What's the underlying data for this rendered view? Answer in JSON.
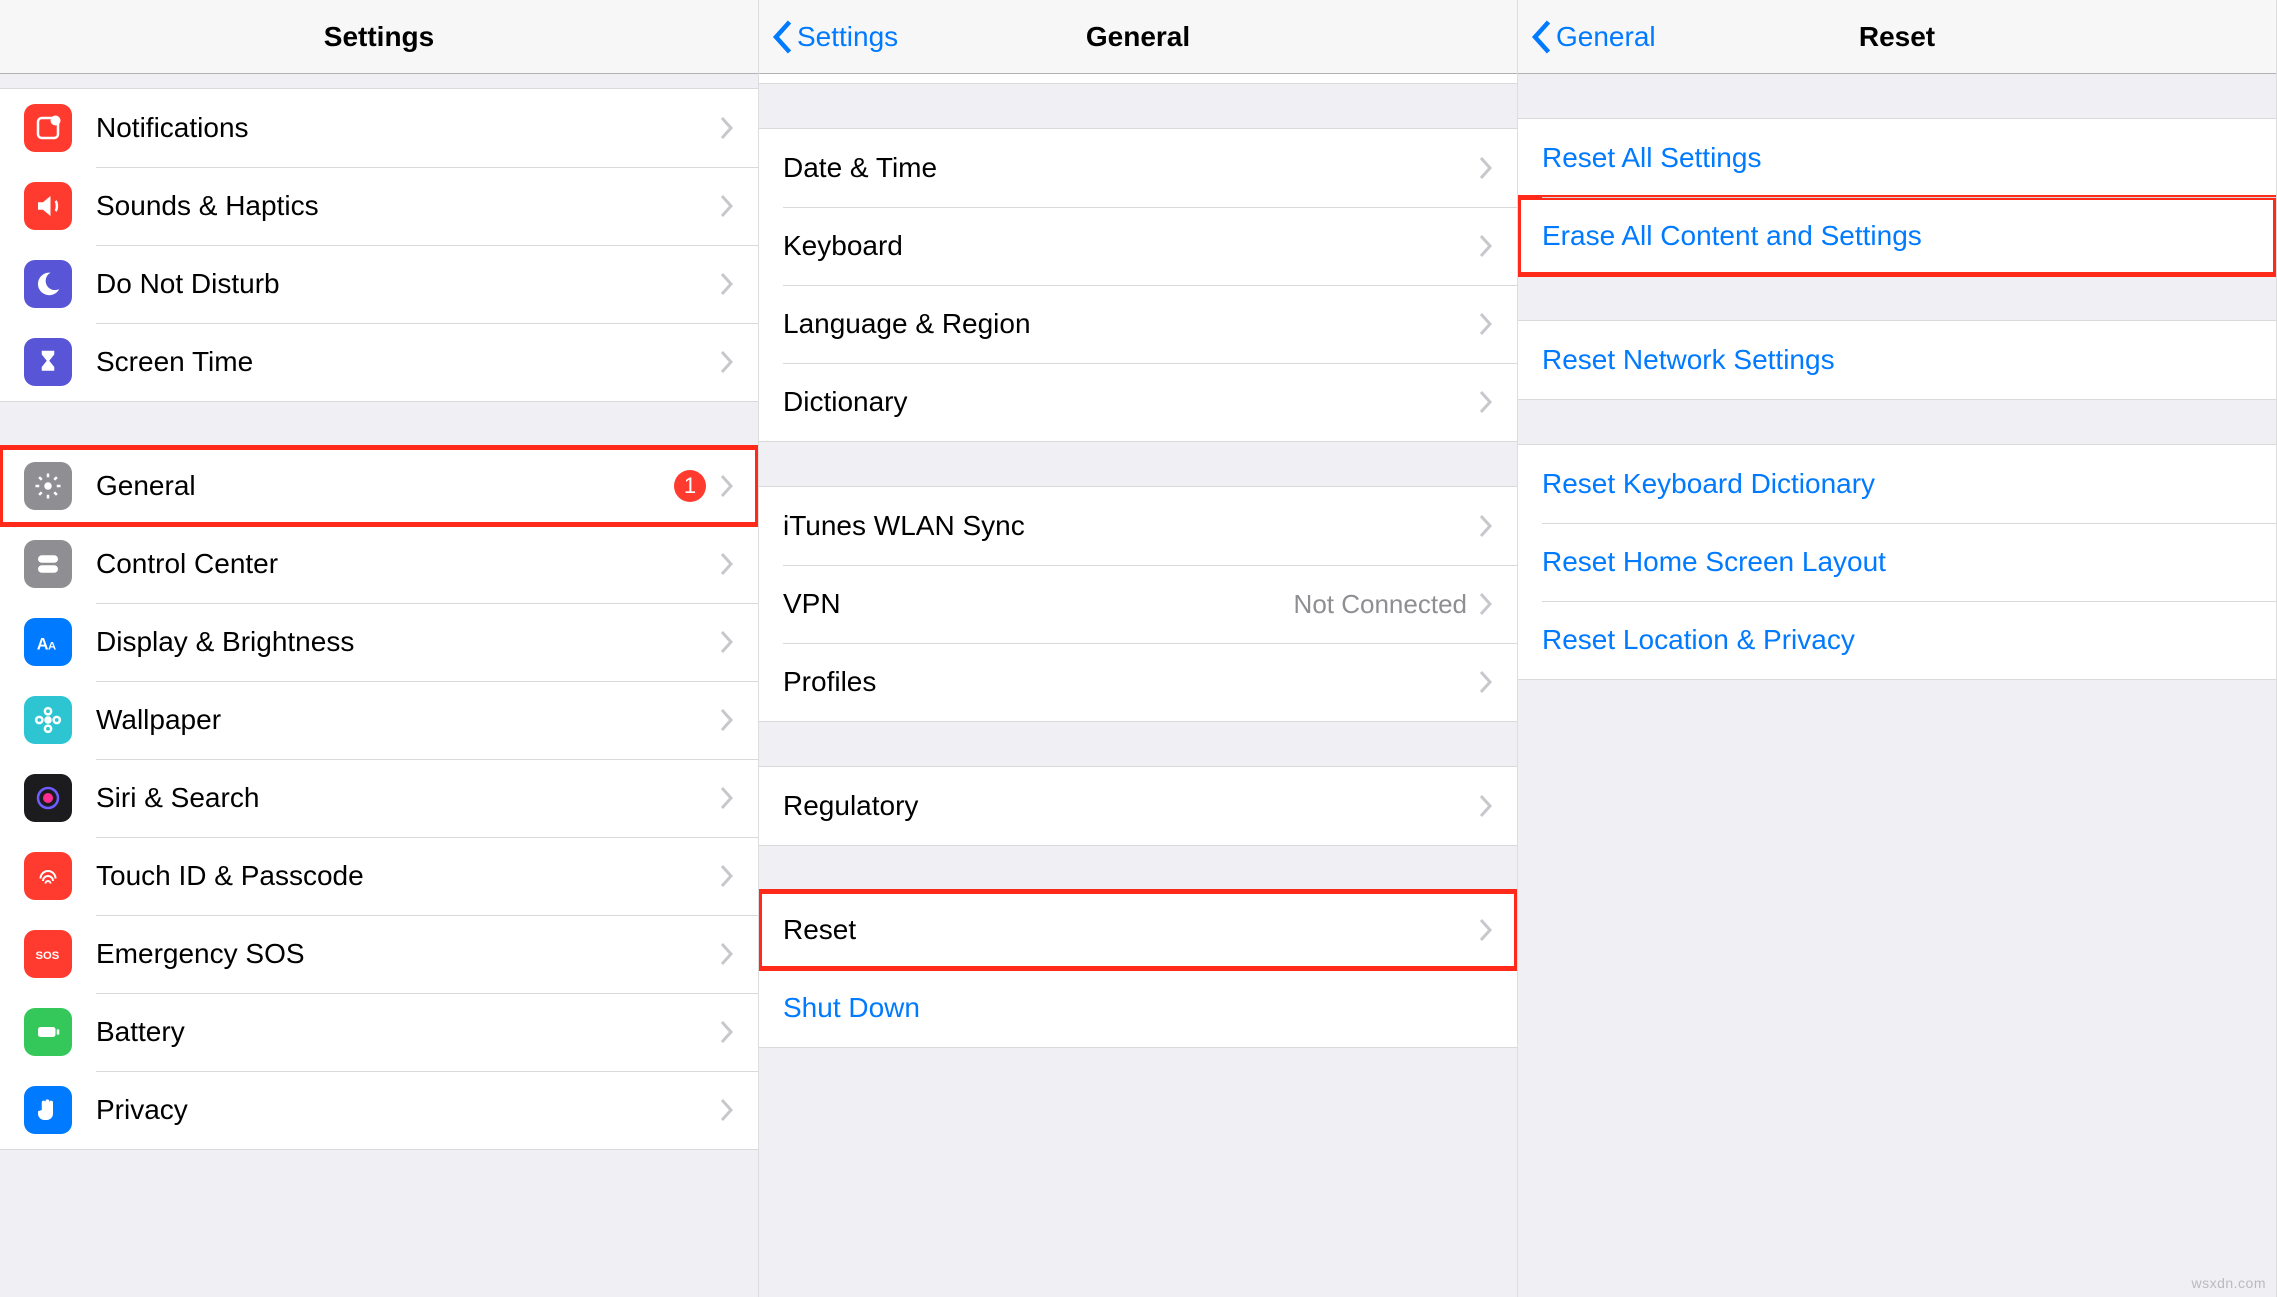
{
  "panel1": {
    "title": "Settings",
    "items": [
      {
        "label": "Notifications"
      },
      {
        "label": "Sounds & Haptics"
      },
      {
        "label": "Do Not Disturb"
      },
      {
        "label": "Screen Time"
      }
    ],
    "items2": [
      {
        "label": "General",
        "badge": "1"
      },
      {
        "label": "Control Center"
      },
      {
        "label": "Display & Brightness"
      },
      {
        "label": "Wallpaper"
      },
      {
        "label": "Siri & Search"
      },
      {
        "label": "Touch ID & Passcode"
      },
      {
        "label": "Emergency SOS"
      },
      {
        "label": "Battery"
      },
      {
        "label": "Privacy"
      }
    ]
  },
  "panel2": {
    "back": "Settings",
    "title": "General",
    "groupA": [
      {
        "label": "Date & Time"
      },
      {
        "label": "Keyboard"
      },
      {
        "label": "Language & Region"
      },
      {
        "label": "Dictionary"
      }
    ],
    "groupB": [
      {
        "label": "iTunes WLAN Sync"
      },
      {
        "label": "VPN",
        "detail": "Not Connected"
      },
      {
        "label": "Profiles"
      }
    ],
    "groupC": [
      {
        "label": "Regulatory"
      }
    ],
    "groupD": [
      {
        "label": "Reset"
      },
      {
        "label": "Shut Down"
      }
    ]
  },
  "panel3": {
    "back": "General",
    "title": "Reset",
    "groupA": [
      {
        "label": "Reset All Settings"
      },
      {
        "label": "Erase All Content and Settings"
      }
    ],
    "groupB": [
      {
        "label": "Reset Network Settings"
      }
    ],
    "groupC": [
      {
        "label": "Reset Keyboard Dictionary"
      },
      {
        "label": "Reset Home Screen Layout"
      },
      {
        "label": "Reset Location & Privacy"
      }
    ]
  },
  "watermark": "wsxdn.com"
}
